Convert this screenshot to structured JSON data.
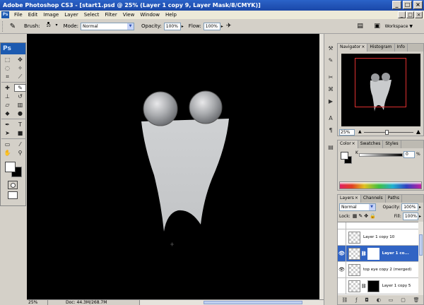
{
  "window": {
    "title": "Adobe Photoshop CS3 - [start1.psd @ 25% (Layer 1 copy 9, Layer Mask/8/CMYK)]",
    "controls": [
      "_",
      "□",
      "×"
    ]
  },
  "menubar": {
    "logo": "Ps",
    "items": [
      "File",
      "Edit",
      "Image",
      "Layer",
      "Select",
      "Filter",
      "View",
      "Window",
      "Help"
    ],
    "doc_controls": [
      "_",
      "□",
      "×"
    ]
  },
  "options": {
    "brush_label": "Brush:",
    "brush_size": "10",
    "mode_label": "Mode:",
    "mode_value": "Normal",
    "opacity_label": "Opacity:",
    "opacity_value": "100%",
    "flow_label": "Flow:",
    "flow_value": "100%",
    "workspace_label": "Workspace ▼"
  },
  "toolbox": {
    "logo": "Ps"
  },
  "statusbar": {
    "zoom": "25%",
    "doc": "Doc: 44.3M/268.7M"
  },
  "navigator": {
    "tabs": [
      "Navigator",
      "Histogram",
      "Info"
    ],
    "zoom": "25%"
  },
  "colorpanel": {
    "tabs": [
      "Color",
      "Swatches",
      "Styles"
    ],
    "channel": "K",
    "value": "0",
    "unit": "%"
  },
  "layers": {
    "tabs": [
      "Layers",
      "Channels",
      "Paths"
    ],
    "blend_mode": "Normal",
    "opacity_label": "Opacity:",
    "opacity_value": "100%",
    "lock_label": "Lock:",
    "fill_label": "Fill:",
    "fill_value": "100%",
    "rows": [
      {
        "name": "Layer 1 copy 10"
      },
      {
        "name": "Layer 1 co..."
      },
      {
        "name": "top eye copy 2 (merged)"
      },
      {
        "name": "Layer 1 copy 5"
      }
    ]
  },
  "colors": {
    "title_bar": "#1a47a8",
    "selection": "#3164c4",
    "canvas": "#000000",
    "figure": "#c9cbcd"
  }
}
